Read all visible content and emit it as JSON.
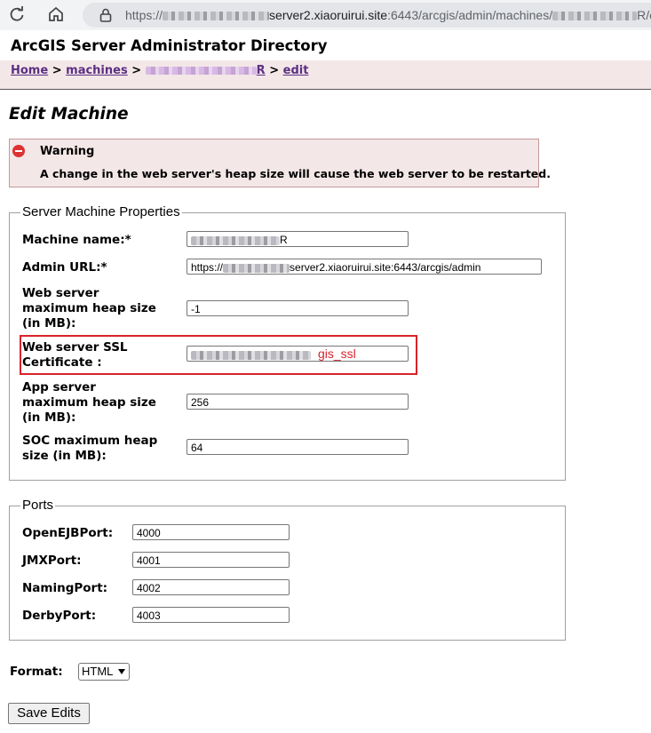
{
  "browser": {
    "url_prefix": "https://",
    "url_host": "server2.xiaoruirui.site",
    "url_rest": ":6443/arcgis/admin/machines/",
    "url_suffix": "R/edit",
    "icons": [
      "reload-icon",
      "home-icon",
      "lock-icon"
    ]
  },
  "header": {
    "title": "ArcGIS Server Administrator Directory"
  },
  "breadcrumb": {
    "home": "Home",
    "sep1": ">",
    "machines": "machines",
    "sep2": ">",
    "machine_suffix": "R",
    "sep3": ">",
    "edit": "edit"
  },
  "page": {
    "heading": "Edit Machine"
  },
  "warning": {
    "title": "Warning",
    "text": "A change in the web server's heap size will cause the web server to be restarted.",
    "icon": "warning-icon",
    "color": "#d33333"
  },
  "machine_props": {
    "legend": "Server Machine Properties",
    "machine_name_label": "Machine name:*",
    "machine_name_value_suffix": "R",
    "admin_url_label": "Admin URL:*",
    "admin_url_prefix": "https://",
    "admin_url_rest": "server2.xiaoruirui.site:6443/arcgis/admin",
    "web_heap_label_1": "Web server",
    "web_heap_label_2": "maximum heap size",
    "web_heap_label_3": "(in MB):",
    "web_heap_value": "-1",
    "ssl_label_1": "Web server SSL",
    "ssl_label_2": "Certificate :",
    "ssl_value_suffix": "gis_ssl",
    "app_heap_label_1": "App server",
    "app_heap_label_2": "maximum heap size",
    "app_heap_label_3": "(in MB):",
    "app_heap_value": "256",
    "soc_heap_label_1": "SOC maximum heap",
    "soc_heap_label_2": "size (in MB):",
    "soc_heap_value": "64"
  },
  "ports": {
    "legend": "Ports",
    "items": [
      {
        "label": "OpenEJBPort:",
        "value": "4000"
      },
      {
        "label": "JMXPort:",
        "value": "4001"
      },
      {
        "label": "NamingPort:",
        "value": "4002"
      },
      {
        "label": "DerbyPort:",
        "value": "4003"
      }
    ]
  },
  "format": {
    "label": "Format:",
    "selected": "HTML"
  },
  "actions": {
    "save_label": "Save Edits"
  },
  "colors": {
    "highlight": "#d9222a",
    "link": "#5b2f83",
    "banner_bg": "#f4e7e8"
  }
}
